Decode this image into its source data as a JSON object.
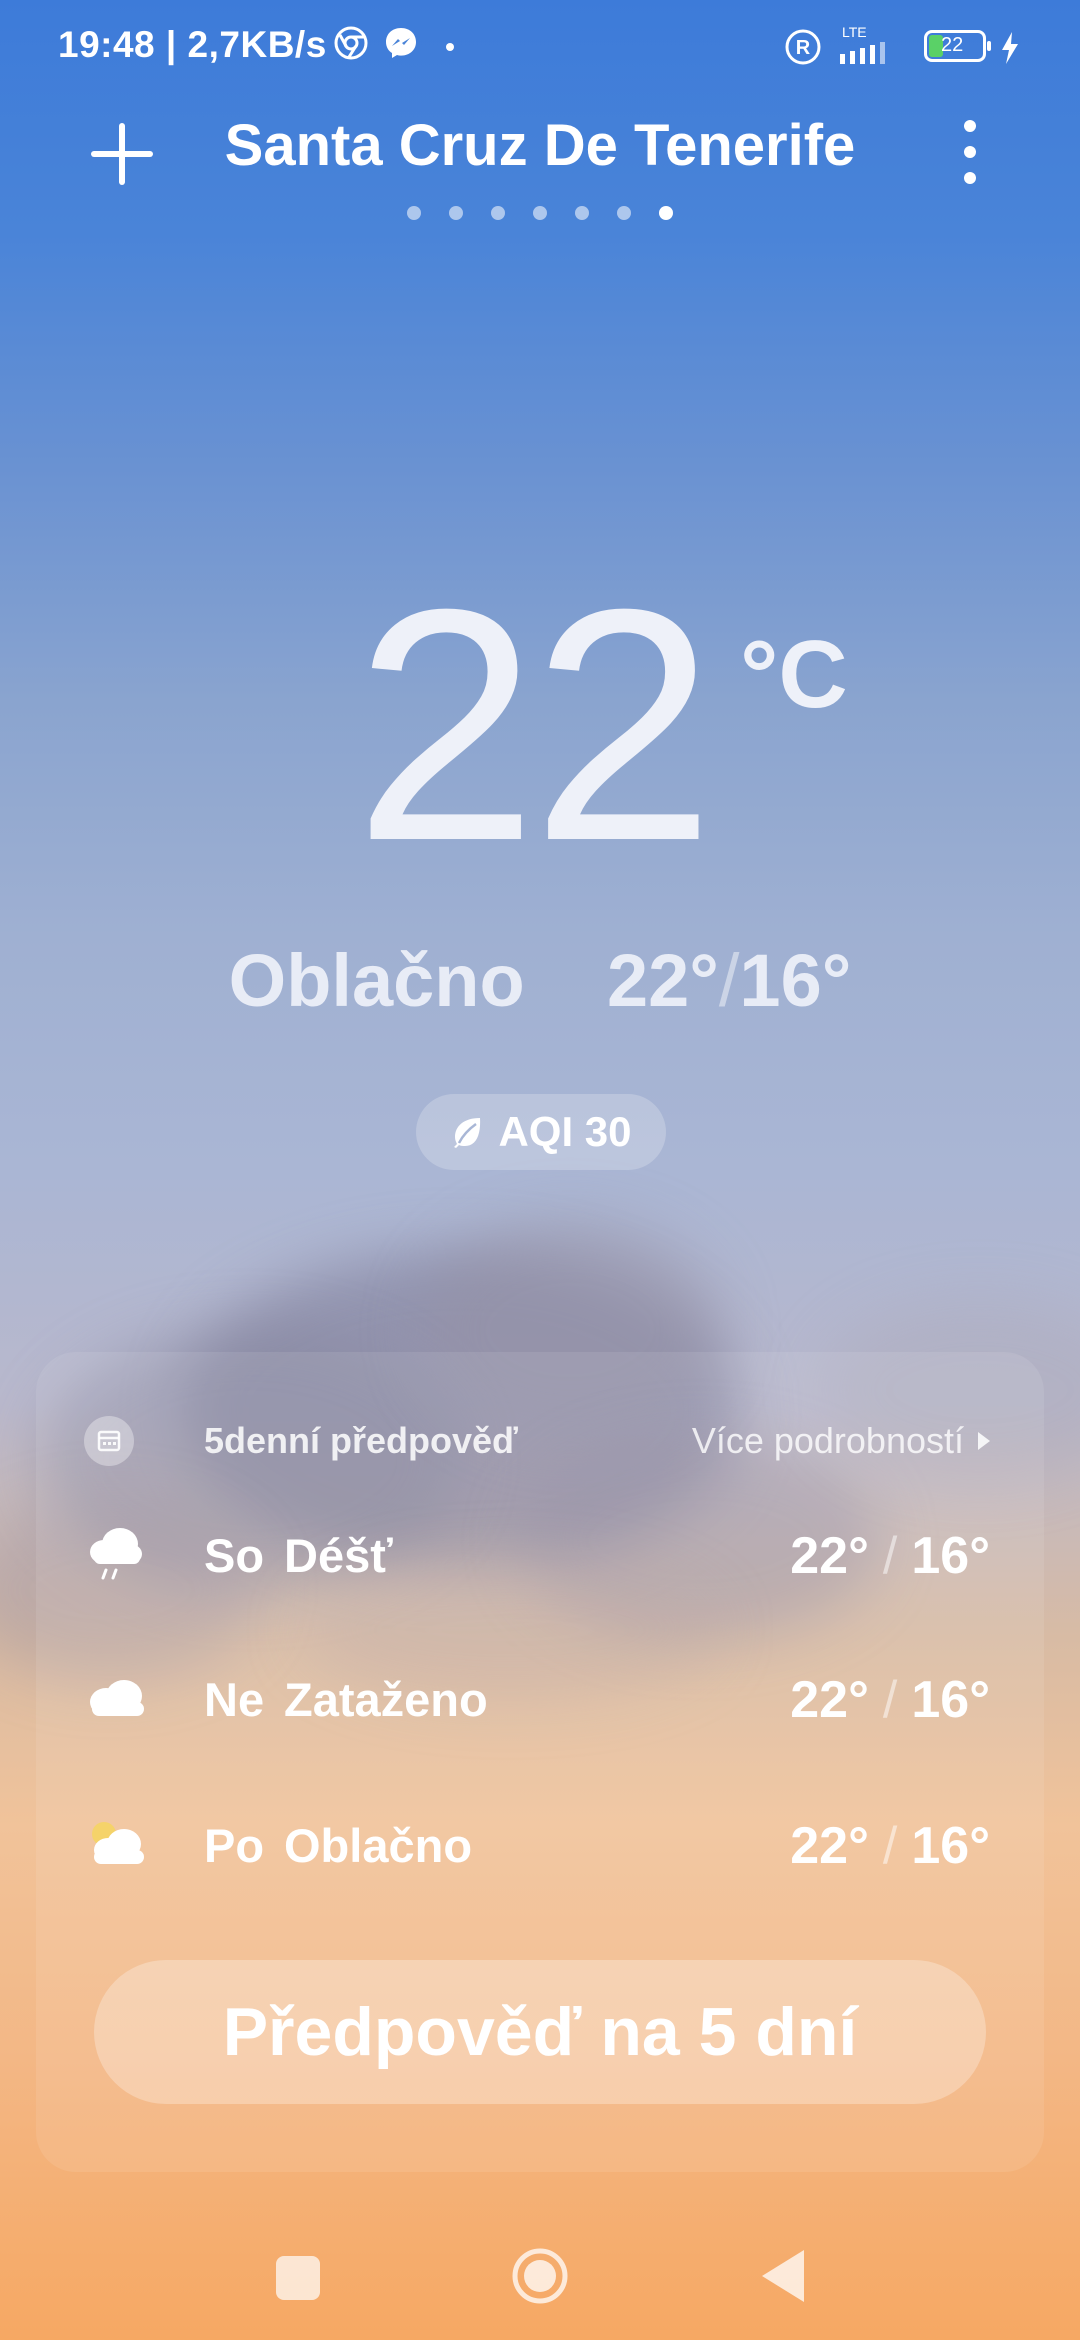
{
  "status_bar": {
    "time_speed": "19:48 | 2,7KB/s",
    "network_label": "LTE",
    "battery": "22"
  },
  "header": {
    "city": "Santa Cruz De Tenerife",
    "page_count": 7,
    "active_page": 7,
    "add_icon": "plus-icon",
    "menu_icon": "more-vert-icon"
  },
  "current": {
    "temperature": "22",
    "unit": "°C",
    "condition": "Oblačno",
    "high": "22°",
    "separator": "/",
    "low": "16°",
    "aqi_label": "AQI 30",
    "aqi_icon": "leaf-icon"
  },
  "forecast_card": {
    "title": "5denní předpověď",
    "more_label": "Více podrobností",
    "rows": [
      {
        "day": "So",
        "desc": "Déšť",
        "high": "22°",
        "low": "16°",
        "icon": "rain-cloud-icon"
      },
      {
        "day": "Ne",
        "desc": "Zataženo",
        "high": "22°",
        "low": "16°",
        "icon": "cloud-icon"
      },
      {
        "day": "Po",
        "desc": "Oblačno",
        "high": "22°",
        "low": "16°",
        "icon": "partly-cloudy-icon"
      }
    ],
    "button_label": "Předpověď na 5 dní"
  },
  "colors": {
    "sky_top": "#3d7bd9",
    "sky_bottom": "#f6a863"
  }
}
